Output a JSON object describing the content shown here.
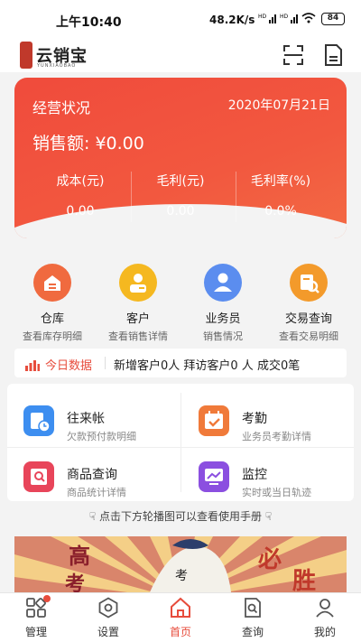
{
  "status_bar": {
    "time": "上午10:40",
    "network_speed": "48.2K/s",
    "signal_1": "HD",
    "signal_2": "HD",
    "battery": "84"
  },
  "app": {
    "logo_text": "云销宝",
    "logo_subtext": "YUNXIAOBAO",
    "icons": [
      "scan-icon",
      "document-icon"
    ]
  },
  "summary_card": {
    "title": "经营状况",
    "date": "2020年07月21日",
    "sales_label": "销售额:",
    "sales_value": "¥0.00",
    "metrics": [
      {
        "label": "成本(元)",
        "value": "0.00"
      },
      {
        "label": "毛利(元)",
        "value": "0.00"
      },
      {
        "label": "毛利率(%)",
        "value": "0.0%"
      }
    ]
  },
  "quick_actions": [
    {
      "name": "仓库",
      "desc": "查看库存明细",
      "icon": "warehouse-icon",
      "color": "#f06a3f"
    },
    {
      "name": "客户",
      "desc": "查看销售详情",
      "icon": "customer-icon",
      "color": "#f5b820"
    },
    {
      "name": "业务员",
      "desc": "销售情况",
      "icon": "salesperson-icon",
      "color": "#5b8def"
    },
    {
      "name": "交易查询",
      "desc": "查看交易明细",
      "icon": "transaction-search-icon",
      "color": "#f39a2b"
    }
  ],
  "today": {
    "label": "今日数据",
    "text": "新增客户0人 拜访客户0 人 成交0笔"
  },
  "tiles": [
    {
      "title": "往来帐",
      "sub": "欠款预付款明细",
      "icon": "ledger-icon",
      "color": "#3d8ef0"
    },
    {
      "title": "考勤",
      "sub": "业务员考勤详情",
      "icon": "attendance-icon",
      "color": "#f07a3a"
    },
    {
      "title": "商品查询",
      "sub": "商品统计详情",
      "icon": "product-search-icon",
      "color": "#e8455a"
    },
    {
      "title": "监控",
      "sub": "实时或当日轨迹",
      "icon": "monitor-icon",
      "color": "#8b4fe0"
    }
  ],
  "hint": "点击下方轮播图可以查看使用手册",
  "banner": {
    "text_1": "高",
    "text_2": "考",
    "text_3": "考",
    "text_4": "必",
    "text_5": "胜"
  },
  "tabs": [
    {
      "label": "管理",
      "icon": "grid-icon",
      "active": false
    },
    {
      "label": "设置",
      "icon": "settings-icon",
      "active": false
    },
    {
      "label": "首页",
      "icon": "home-icon",
      "active": true
    },
    {
      "label": "查询",
      "icon": "query-icon",
      "active": false
    },
    {
      "label": "我的",
      "icon": "profile-icon",
      "active": false
    }
  ],
  "colors": {
    "accent": "#e74c3c",
    "card": "#f2583f"
  }
}
